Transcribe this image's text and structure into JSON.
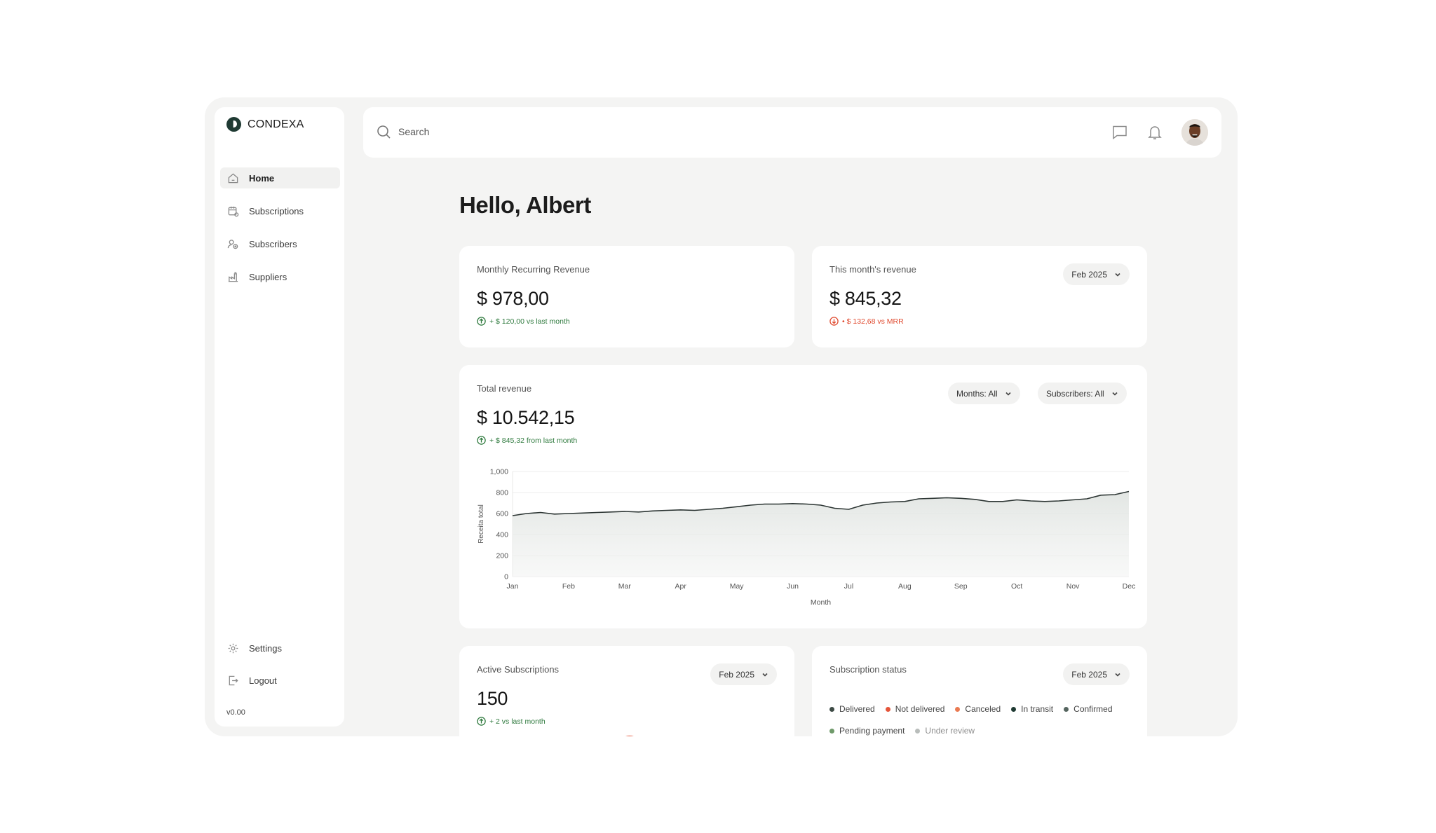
{
  "brand": {
    "name": "CONDEXA"
  },
  "sidebar": {
    "items": [
      {
        "label": "Home",
        "icon": "home-icon",
        "active": true
      },
      {
        "label": "Subscriptions",
        "icon": "calendar-icon"
      },
      {
        "label": "Subscribers",
        "icon": "users-icon"
      },
      {
        "label": "Suppliers",
        "icon": "factory-icon"
      }
    ],
    "bottom": [
      {
        "label": "Settings",
        "icon": "gear-icon"
      },
      {
        "label": "Logout",
        "icon": "logout-icon"
      }
    ],
    "version": "v0.00"
  },
  "topbar": {
    "search_placeholder": "Search",
    "icons": [
      "message-icon",
      "bell-icon"
    ],
    "avatar": "user-avatar"
  },
  "greeting": "Hello, Albert",
  "mrr": {
    "label": "Monthly Recurring Revenue",
    "value": "$ 978,00",
    "delta": "+ $ 120,00 vs last month",
    "delta_color": "#2f7a3e"
  },
  "month_revenue": {
    "label": "This month's revenue",
    "value": "$ 845,32",
    "delta": "• $ 132,68 vs MRR",
    "delta_color": "#e04a2f",
    "filter": "Feb 2025"
  },
  "total_revenue": {
    "label": "Total revenue",
    "value": "$ 10.542,15",
    "delta": "+ $ 845,32 from last month",
    "filters": [
      "Months: All",
      "Subscribers: All"
    ]
  },
  "active_subscriptions": {
    "label": "Active Subscriptions",
    "value": "150",
    "delta": "+ 2 vs last month",
    "filter": "Feb 2025"
  },
  "subscription_status": {
    "label": "Subscription status",
    "filter": "Feb 2025",
    "legend": [
      {
        "label": "Delivered",
        "color": "#3d4a45"
      },
      {
        "label": "Not delivered",
        "color": "#e5553a"
      },
      {
        "label": "Canceled",
        "color": "#ea7a52"
      },
      {
        "label": "In transit",
        "color": "#1f3a33"
      },
      {
        "label": "Confirmed",
        "color": "#55655f"
      },
      {
        "label": "Pending payment",
        "color": "#6f9a6a"
      },
      {
        "label": "Under review",
        "color": "#b9bdbb"
      }
    ]
  },
  "chart_data": {
    "type": "area",
    "ylabel": "Receita total",
    "xlabel": "Month",
    "ylim": [
      0,
      1000
    ],
    "yticks": [
      "0",
      "200",
      "400",
      "600",
      "800",
      "1,000"
    ],
    "xticks": [
      "Jan",
      "Feb",
      "Mar",
      "Apr",
      "May",
      "Jun",
      "Jul",
      "Aug",
      "Sep",
      "Oct",
      "Nov",
      "Dec"
    ],
    "grid": true,
    "x": [
      0,
      0.25,
      0.5,
      0.75,
      1,
      1.25,
      1.5,
      1.75,
      2,
      2.25,
      2.5,
      2.75,
      3,
      3.25,
      3.5,
      3.75,
      4,
      4.25,
      4.5,
      4.75,
      5,
      5.25,
      5.5,
      5.75,
      6,
      6.25,
      6.5,
      6.75,
      7,
      7.25,
      7.5,
      7.75,
      8,
      8.25,
      8.5,
      8.75,
      9,
      9.25,
      9.5,
      9.75,
      10,
      10.25,
      10.5,
      10.75,
      11
    ],
    "y": [
      580,
      600,
      610,
      595,
      600,
      605,
      610,
      615,
      620,
      615,
      625,
      630,
      635,
      630,
      640,
      650,
      665,
      680,
      690,
      690,
      695,
      690,
      680,
      650,
      640,
      680,
      700,
      710,
      715,
      740,
      745,
      750,
      745,
      735,
      715,
      715,
      730,
      720,
      715,
      720,
      730,
      740,
      775,
      780,
      810
    ],
    "line_color": "#2c3533"
  }
}
